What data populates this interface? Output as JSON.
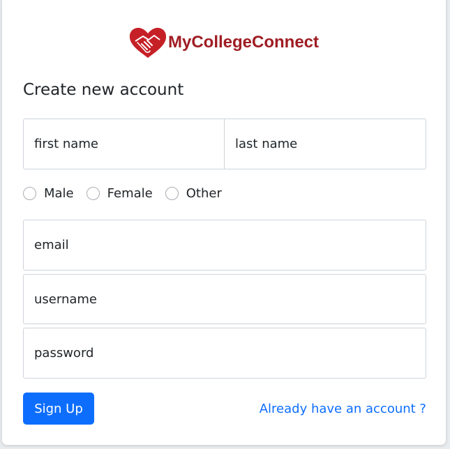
{
  "brand": {
    "name": "MyCollegeConnect",
    "logo_icon": "heart-handshake-icon",
    "color": "#9f1d23"
  },
  "form": {
    "heading": "Create new account",
    "first_name_placeholder": "first name",
    "last_name_placeholder": "last name",
    "gender_options": [
      "Male",
      "Female",
      "Other"
    ],
    "email_placeholder": "email",
    "username_placeholder": "username",
    "password_placeholder": "password",
    "submit_label": "Sign Up",
    "login_link": "Already have an account ?"
  },
  "colors": {
    "primary": "#0d6efd",
    "text": "#212529",
    "border": "#ced4da"
  }
}
